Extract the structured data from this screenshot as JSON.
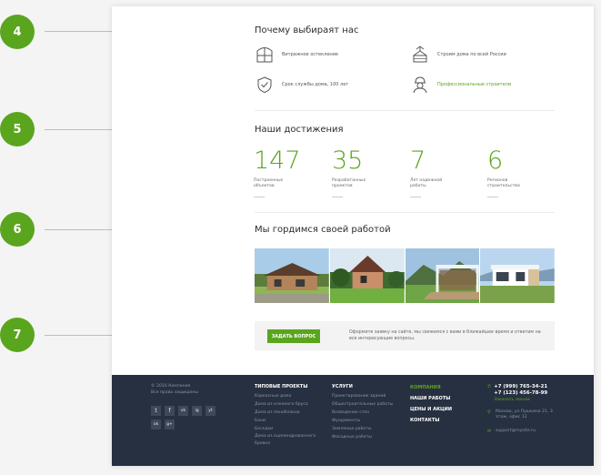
{
  "markers": [
    "4",
    "5",
    "6",
    "7"
  ],
  "why_us": {
    "title": "Почему выбираят нас",
    "features": [
      {
        "icon": "window-icon",
        "label": "Витражное остекление",
        "accent": false
      },
      {
        "icon": "crane-house-icon",
        "label": "Строим дома по всей России",
        "accent": false
      },
      {
        "icon": "shield-check-icon",
        "label": "Срок службы дома, 100 лет",
        "accent": false
      },
      {
        "icon": "builder-icon",
        "label": "Профессиональные строители",
        "accent": true
      }
    ]
  },
  "achievements": {
    "title": "Наши достижения",
    "stats": [
      {
        "value": "147",
        "label": "Построенных объектов"
      },
      {
        "value": "35",
        "label": "Разработанных проектов"
      },
      {
        "value": "7",
        "label": "Лет надежной работы"
      },
      {
        "value": "6",
        "label": "Регионов строительства"
      }
    ]
  },
  "gallery": {
    "title": "Мы гордимся своей работой",
    "photos": [
      "house-photo-1",
      "house-photo-2",
      "house-photo-3",
      "house-photo-4"
    ]
  },
  "question": {
    "button": "ЗАДАТЬ ВОПРОС",
    "text": "Оформите заявку на сайте, мы свяжемся с вами в ближайшее время и ответим на все интересующие вопросы."
  },
  "footer": {
    "copyright": "© 2016 Компания",
    "rights": "Все права защищены",
    "socials": [
      "t",
      "f",
      "vk",
      "ig",
      "yt",
      "ok",
      "g+"
    ],
    "projects": {
      "heading": "ТИПОВЫЕ ПРОЕКТЫ",
      "items": [
        "Каркасные дома",
        "Дома из клееного бруса",
        "Дома из пеноблоков",
        "Бани",
        "Беседки",
        "Дома из оцилиндрованного бревна"
      ]
    },
    "services": {
      "heading": "УСЛУГИ",
      "items": [
        "Проектирование зданий",
        "Общестроительные работы",
        "Возведение стен",
        "Фундаменты",
        "Земляные работы",
        "Фасадные работы"
      ]
    },
    "nav": [
      {
        "label": "КОМПАНИЯ",
        "accent": true
      },
      {
        "label": "НАШИ РАБОТЫ",
        "accent": false
      },
      {
        "label": "ЦЕНЫ И АКЦИИ",
        "accent": false
      },
      {
        "label": "КОНТАКТЫ",
        "accent": false
      }
    ],
    "contacts": {
      "phone1": "+7 (999) 765-34-21",
      "phone2": "+7 (123) 456-78-99",
      "callback": "Заказать звонок",
      "address": "Москва, ул.Пушкина 21, 3 этаж, офис 12",
      "email": "support@mysite.ru"
    }
  },
  "colors": {
    "accent": "#5aa51e",
    "footer_bg": "#273040"
  }
}
